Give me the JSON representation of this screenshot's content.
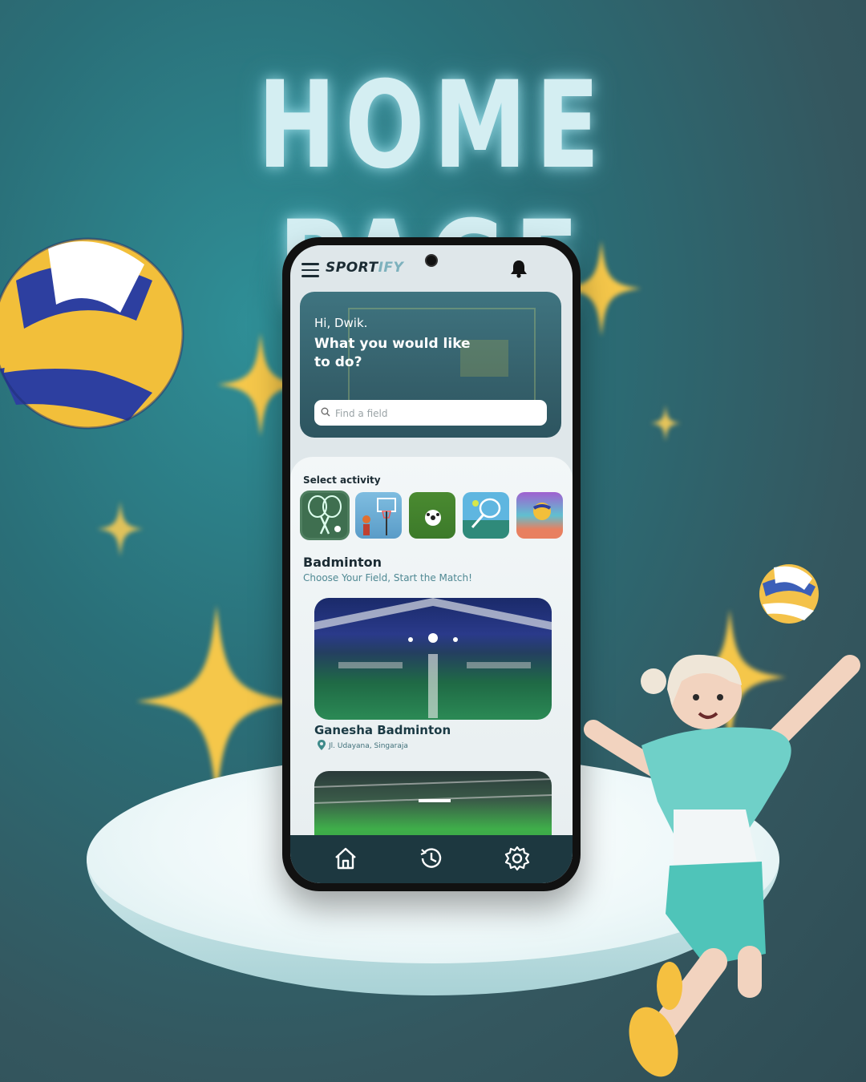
{
  "headline": "HOME PAGE",
  "colors": {
    "accent": "#7db1bd",
    "dark": "#1b2b33",
    "navbar": "#1d3840"
  },
  "app": {
    "logo_part1": "SPORT",
    "logo_part2": "IFY",
    "menu_icon": "hamburger-menu-icon",
    "notification_icon": "bell-icon"
  },
  "hero": {
    "greeting": "Hi, Dwik.",
    "question": "What you would like to do?",
    "search": {
      "placeholder": "Find a field",
      "value": "",
      "icon": "search-icon"
    }
  },
  "activities": {
    "title": "Select activity",
    "items": [
      {
        "label": "Badminton",
        "selected": true
      },
      {
        "label": "Basketball",
        "selected": false
      },
      {
        "label": "Football",
        "selected": false
      },
      {
        "label": "Tennis",
        "selected": false
      },
      {
        "label": "Volleyball",
        "selected": false
      }
    ]
  },
  "section": {
    "title": "Badminton",
    "subtitle": "Choose Your Field, Start the Match!"
  },
  "venues": [
    {
      "name": "Ganesha Badminton",
      "location": "Jl. Udayana, Singaraja"
    }
  ],
  "navbar": {
    "items": [
      {
        "icon": "home-icon"
      },
      {
        "icon": "history-icon"
      },
      {
        "icon": "settings-gear-icon"
      }
    ]
  }
}
